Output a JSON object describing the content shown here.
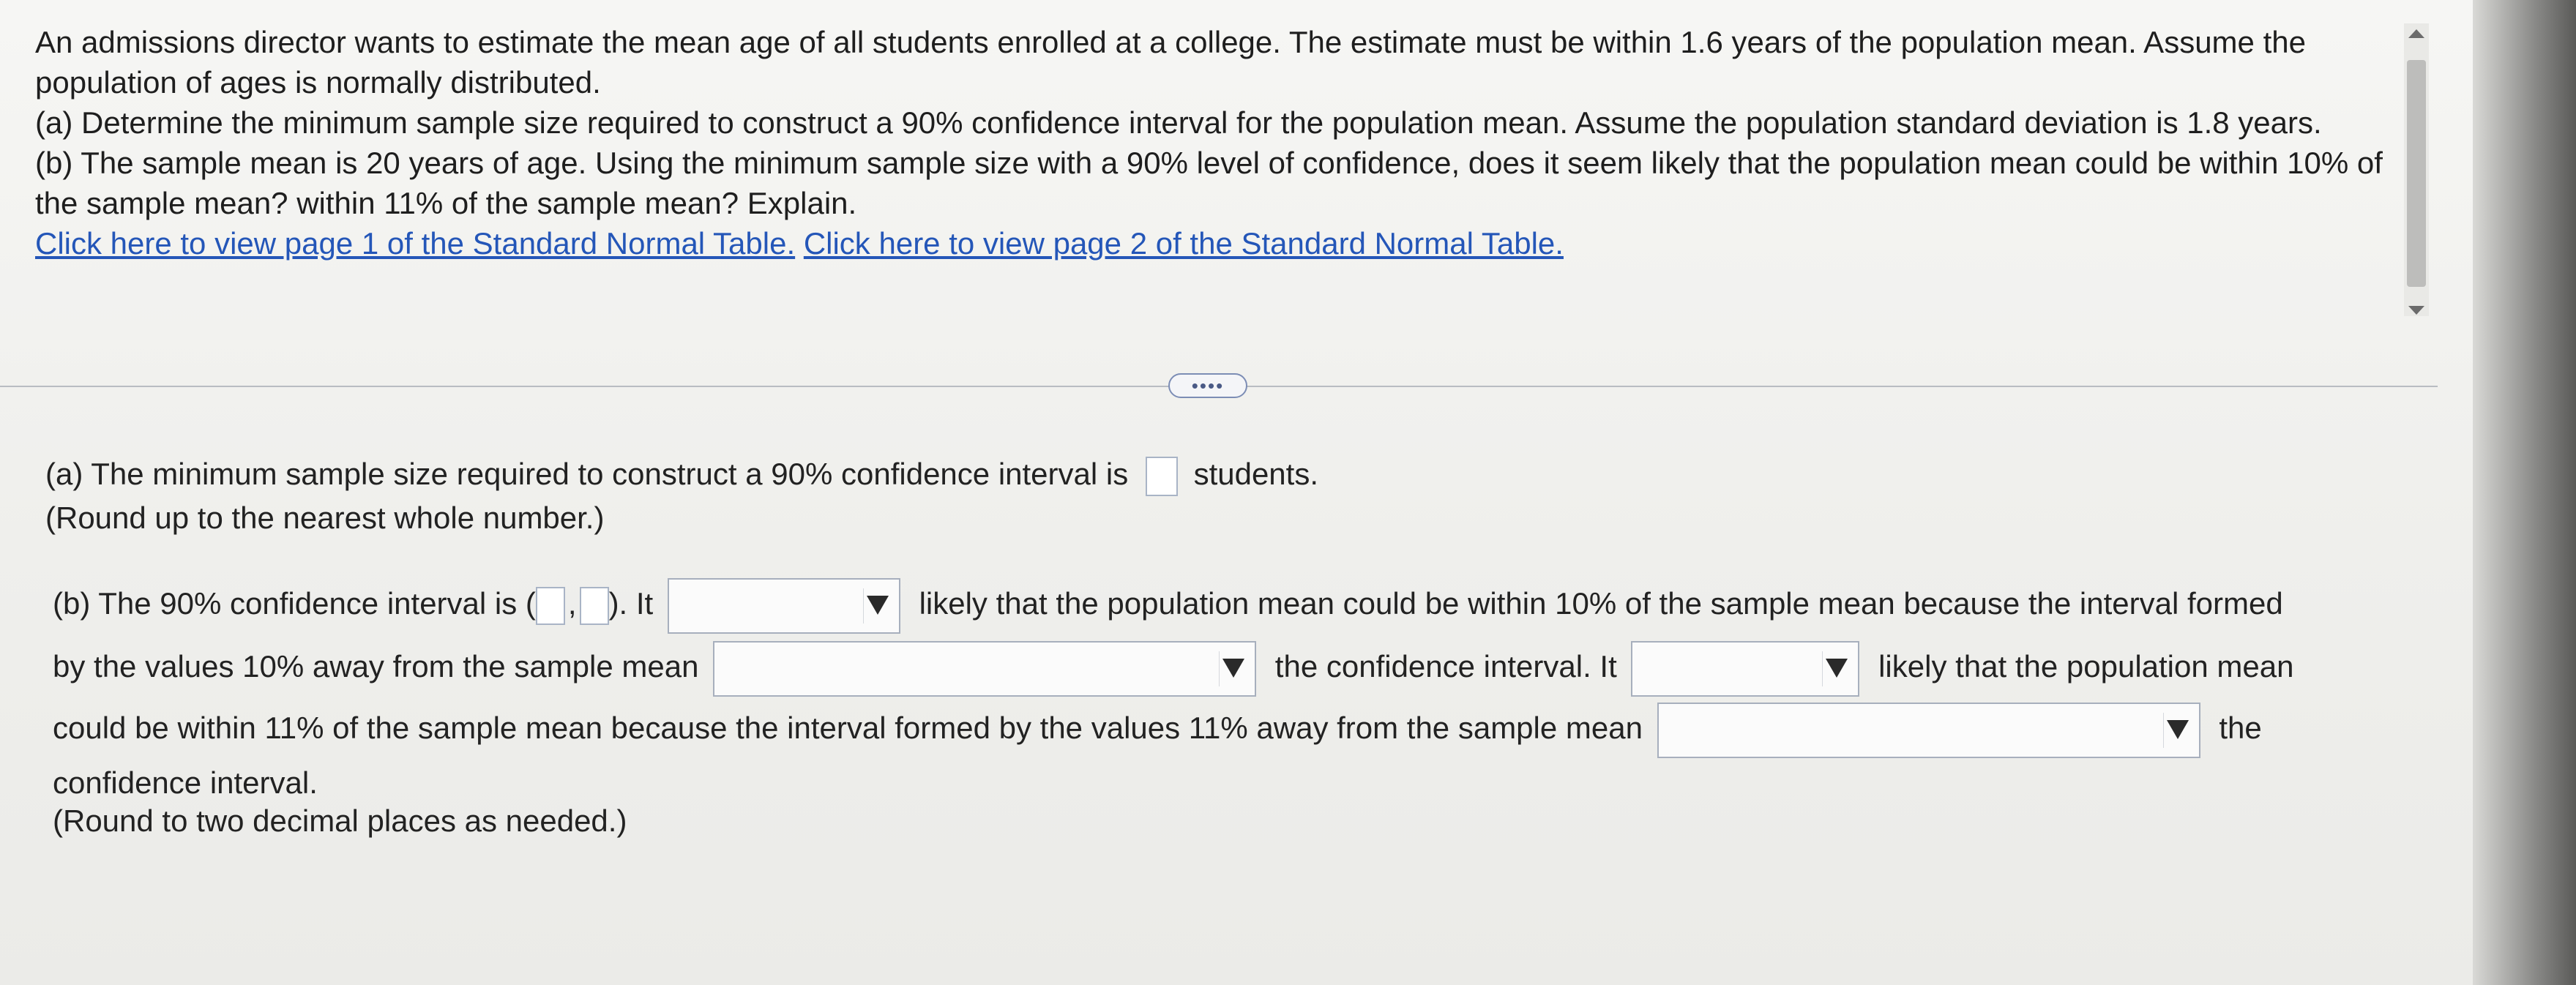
{
  "question": {
    "intro": "An admissions director wants to estimate the mean age of all students enrolled at a college. The estimate must be within 1.6 years of the population mean. Assume the population of ages is normally distributed.",
    "part_a": "(a) Determine the minimum sample size required to construct a 90% confidence interval for the population mean. Assume the population standard deviation is 1.8 years.",
    "part_b": "(b) The sample mean is 20 years of age. Using the minimum sample size with a 90% level of confidence, does it seem likely that the population mean could be within 10% of the sample mean? within 11% of the sample mean? Explain.",
    "link1": "Click here to view page 1 of the Standard Normal Table.",
    "link2": "Click here to view page 2 of the Standard Normal Table."
  },
  "expand_label": "••••",
  "answers": {
    "a_text_before": "(a) The minimum sample size required to construct a 90% confidence interval is",
    "a_text_after": "students.",
    "a_note": "(Round up to the nearest whole number.)",
    "b_text1": "(b) The 90% confidence interval is (",
    "b_comma": ",",
    "b_text2": "). It",
    "b_text3": "likely that the population mean could be within 10% of the sample mean because the interval formed",
    "b_text4": "by the values 10% away from the sample mean",
    "b_text5": "the confidence interval. It",
    "b_text6": "likely that the population mean",
    "b_text7": "could be within 11% of the sample mean because the interval formed by the values 11% away from the sample mean",
    "b_text8": "the",
    "b_text9": "confidence interval.",
    "b_note": "(Round to two decimal places as needed.)"
  }
}
